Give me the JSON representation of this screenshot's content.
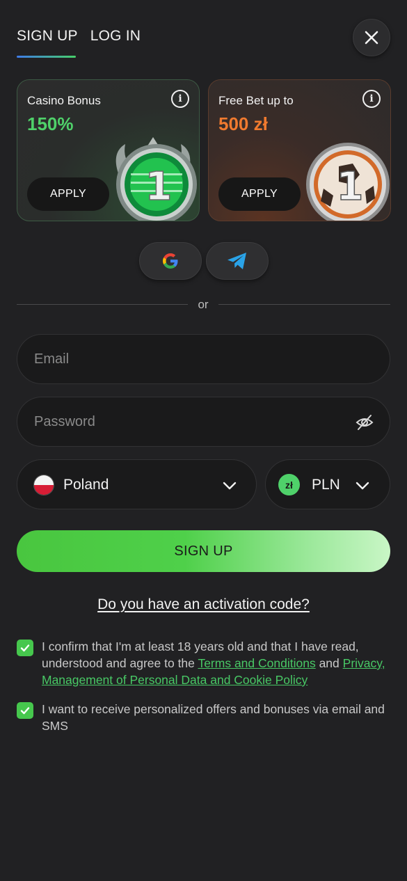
{
  "tabs": {
    "signup": "SIGN UP",
    "login": "LOG IN"
  },
  "bonuses": {
    "casino": {
      "title": "Casino Bonus",
      "value": "150%",
      "apply": "APPLY",
      "medal_number": "1"
    },
    "freebet": {
      "title": "Free Bet up to",
      "value": "500 zł",
      "apply": "APPLY",
      "medal_number": "1"
    }
  },
  "social": {
    "google": "G"
  },
  "divider_text": "or",
  "form": {
    "email_placeholder": "Email",
    "password_placeholder": "Password",
    "country": "Poland",
    "currency": "PLN",
    "currency_symbol": "zł",
    "submit": "SIGN UP"
  },
  "activation_link": "Do you have an activation code?",
  "consent": {
    "age_text_1": "I confirm that I'm at least 18 years old and that I have read, understood and agree to the ",
    "terms_link": "Terms and Conditions",
    "and": " and ",
    "privacy_link": "Privacy, Management of Personal Data and Cookie Policy",
    "marketing_text": "I want to receive personalized offers and bonuses via email and SMS"
  },
  "colors": {
    "accent_green": "#4fd16a",
    "accent_orange": "#f07a2f",
    "background": "#212123"
  }
}
